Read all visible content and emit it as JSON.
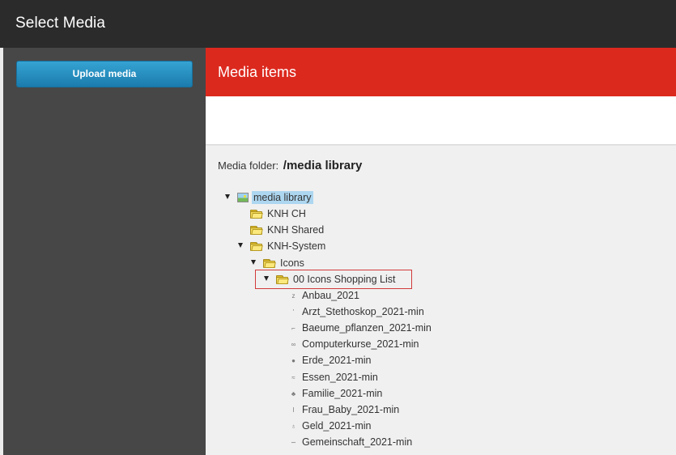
{
  "topbar": {
    "title": "Select Media"
  },
  "sidebar": {
    "upload_label": "Upload media"
  },
  "header": {
    "title": "Media items"
  },
  "content": {
    "folder_label": "Media folder:",
    "folder_path": "/media library"
  },
  "tree": {
    "root": "media library",
    "folders": [
      "KNH CH",
      "KNH Shared",
      "KNH-System",
      "Icons",
      "00 Icons Shopping List"
    ],
    "items": [
      "Anbau_2021",
      "Arzt_Stethoskop_2021-min",
      "Baeume_pflanzen_2021-min",
      "Computerkurse_2021-min",
      "Erde_2021-min",
      "Essen_2021-min",
      "Familie_2021-min",
      "Frau_Baby_2021-min",
      "Geld_2021-min",
      "Gemeinschaft_2021-min"
    ]
  },
  "colors": {
    "header_red": "#dc291e",
    "button_blue": "#2a8fc1",
    "topbar": "#2b2b2b",
    "sidebar": "#474747"
  }
}
